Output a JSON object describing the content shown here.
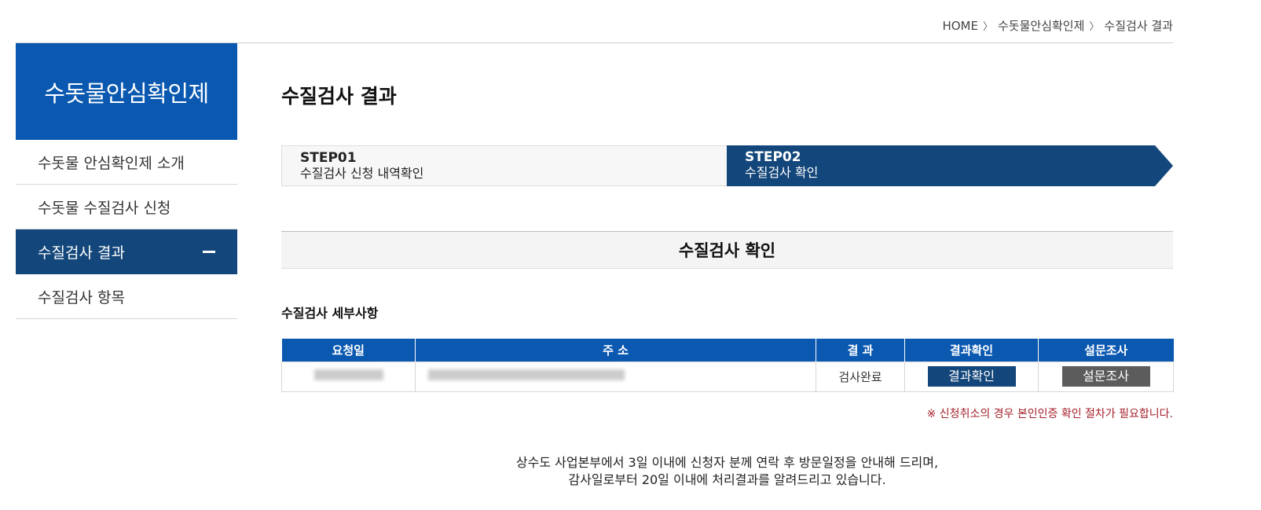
{
  "breadcrumb": {
    "home": "HOME",
    "level1": "수돗물안심확인제",
    "level2": "수질검사 결과"
  },
  "sidebar": {
    "title": "수돗물안심확인제",
    "items": [
      {
        "label": "수돗물 안심확인제 소개"
      },
      {
        "label": "수돗물 수질검사 신청"
      },
      {
        "label": "수질검사 결과",
        "active": true
      },
      {
        "label": "수질검사 항목"
      }
    ]
  },
  "page": {
    "title": "수질검사 결과"
  },
  "steps": [
    {
      "num": "STEP01",
      "label": "수질검사 신청 내역확인"
    },
    {
      "num": "STEP02",
      "label": "수질검사 확인",
      "active": true
    }
  ],
  "section": {
    "title": "수질검사 확인",
    "subtitle": "수질검사 세부사항"
  },
  "table": {
    "headers": [
      "요청일",
      "주 소",
      "결 과",
      "결과확인",
      "설문조사"
    ],
    "row": {
      "result": "검사완료",
      "check_button": "결과확인",
      "survey_button": "설문조사"
    }
  },
  "notice": "※ 신청취소의 경우 본인인증 확인 절차가 필요합니다.",
  "footer": {
    "line1": "상수도 사업본부에서 3일 이내에 신청자 분께 연락 후 방문일정을 안내해 드리며,",
    "line2": "감사일로부터 20일 이내에 처리결과를 알려드리고 있습니다."
  },
  "colors": {
    "primary_blue": "#0a58b0",
    "dark_navy": "#13467a",
    "notice_red": "#a5202b"
  }
}
